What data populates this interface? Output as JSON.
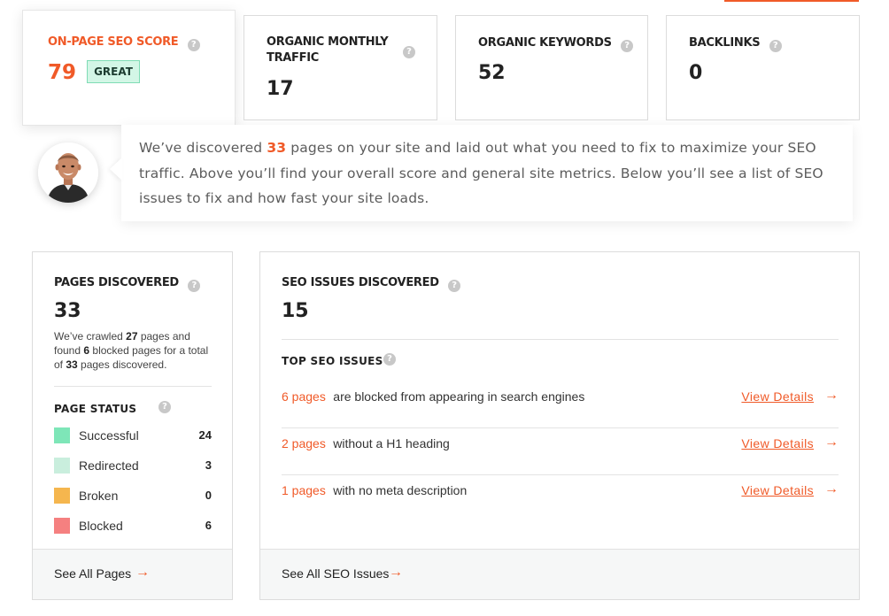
{
  "metrics": {
    "onpage": {
      "title": "ON-PAGE SEO SCORE",
      "value": "79",
      "badge": "GREAT"
    },
    "traffic": {
      "title_line1": "ORGANIC MONTHLY",
      "title_line2": "TRAFFIC",
      "value": "17"
    },
    "keywords": {
      "title": "ORGANIC KEYWORDS",
      "value": "52"
    },
    "backlinks": {
      "title": "BACKLINKS",
      "value": "0"
    }
  },
  "intro": {
    "part1": "We’ve discovered ",
    "pages_count": "33",
    "part2": " pages on your site and laid out what you need to fix to maximize your SEO traffic. Above you’ll find your overall score and general site metrics. Below you’ll see a list of SEO issues to fix and how fast your site loads."
  },
  "pages_discovered": {
    "title": "PAGES DISCOVERED",
    "value": "33",
    "desc": {
      "t1": "We’ve crawled ",
      "crawled": "27",
      "t2": " pages and found ",
      "blocked": "6",
      "t3": " blocked pages for a total of ",
      "total": "33",
      "t4": " pages discovered."
    },
    "status_title": "PAGE STATUS",
    "statuses": [
      {
        "label": "Successful",
        "count": "24",
        "color": "#7ee6b8"
      },
      {
        "label": "Redirected",
        "count": "3",
        "color": "#c9eedd"
      },
      {
        "label": "Broken",
        "count": "0",
        "color": "#f5b64e"
      },
      {
        "label": "Blocked",
        "count": "6",
        "color": "#f58080"
      }
    ],
    "footer_link": "See All Pages"
  },
  "seo_issues": {
    "title": "SEO ISSUES DISCOVERED",
    "value": "15",
    "top_title": "TOP SEO ISSUES",
    "issues": [
      {
        "count": "6 pages",
        "text": "are blocked from appearing in search engines",
        "link": "View Details"
      },
      {
        "count": "2 pages",
        "text": "without a H1 heading",
        "link": "View Details"
      },
      {
        "count": "1 pages",
        "text": "with no meta description",
        "link": "View Details"
      }
    ],
    "footer_link": "See All SEO Issues"
  },
  "icons": {
    "help": "?",
    "arrow": "→"
  },
  "colors": {
    "accent": "#f05a28",
    "great_bg": "#d3f6e6"
  }
}
